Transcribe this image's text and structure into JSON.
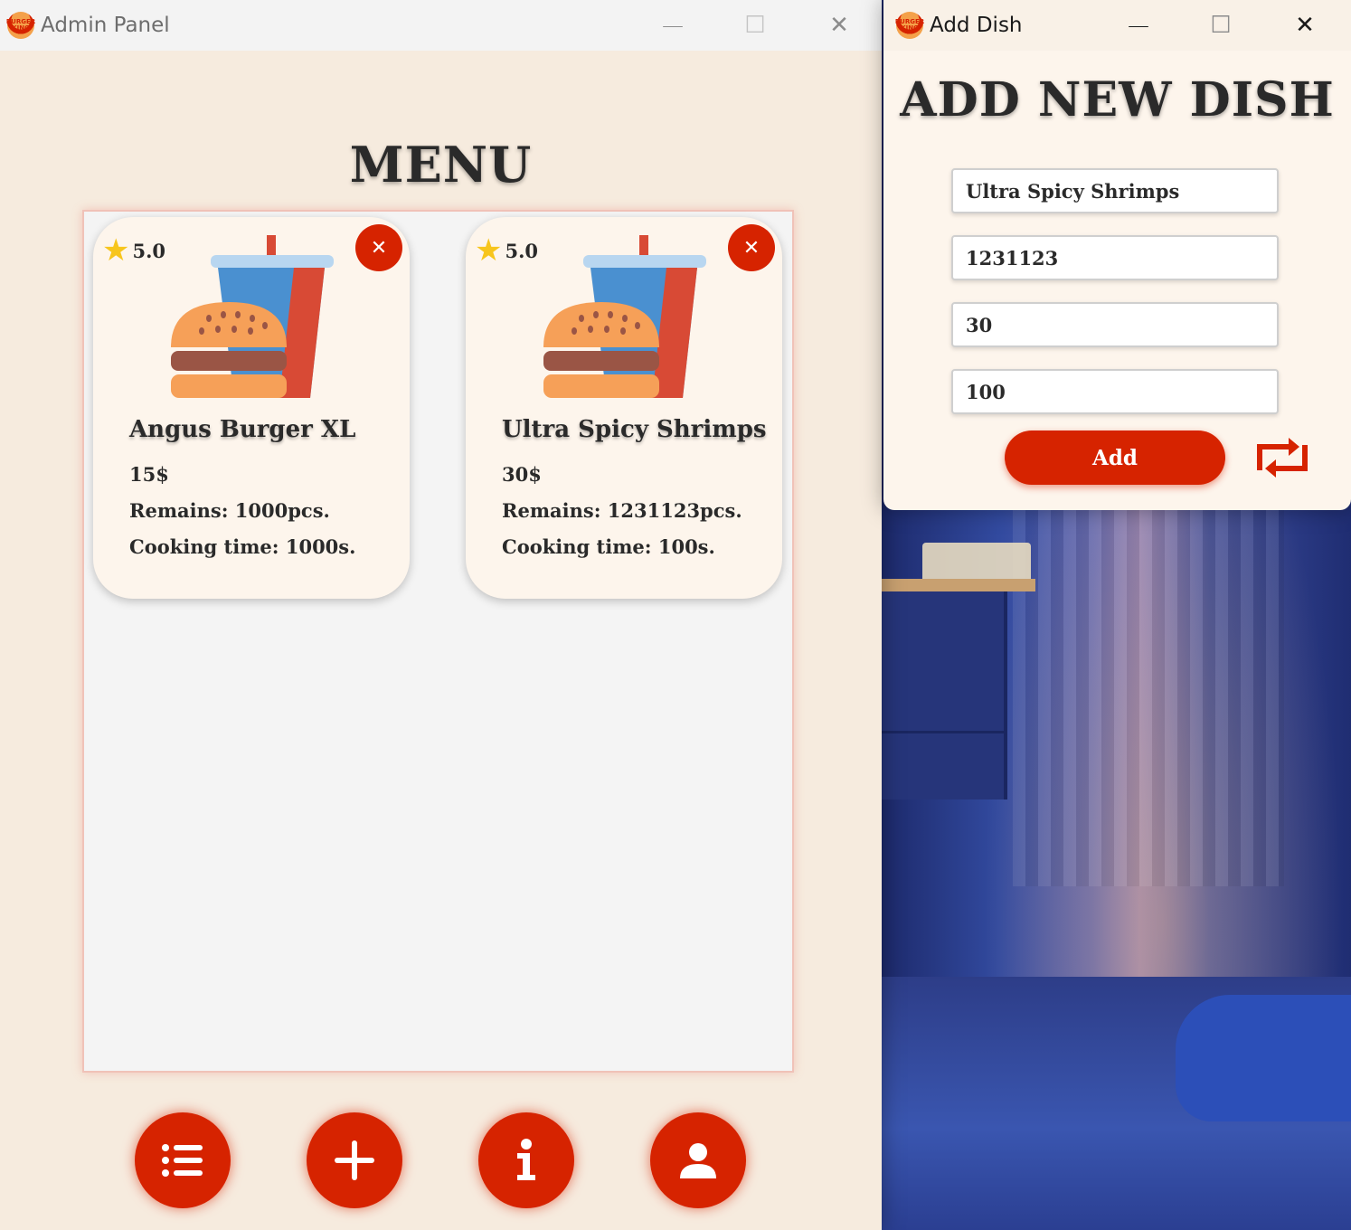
{
  "colors": {
    "accent": "#d62300",
    "cream": "#f6ebde",
    "card": "#fdf5ec",
    "star": "#f7c51c",
    "text": "#2a2a2a"
  },
  "admin_window": {
    "title": "Admin Panel",
    "menu_heading": "MENU",
    "dishes": [
      {
        "rating": "5.0",
        "name": "Angus Burger XL",
        "price": "15$",
        "remains": "Remains: 1000pcs.",
        "cooking": "Cooking time: 1000s.",
        "image_icon": "burger-drink-icon"
      },
      {
        "rating": "5.0",
        "name": "Ultra Spicy Shrimps",
        "price": "30$",
        "remains": "Remains: 1231123pcs.",
        "cooking": "Cooking time: 100s.",
        "image_icon": "burger-drink-icon"
      }
    ],
    "nav_icons": [
      "list-icon",
      "plus-icon",
      "info-icon",
      "user-icon"
    ]
  },
  "add_window": {
    "title": "Add Dish",
    "heading": "ADD NEW DISH",
    "fields": {
      "name": "Ultra Spicy Shrimps",
      "remains": "1231123",
      "price": "30",
      "cooking_time": "100"
    },
    "add_label": "Add",
    "reset_icon": "refresh-icon"
  },
  "window_controls": {
    "minimize": "—",
    "maximize": "☐",
    "close": "✕"
  }
}
